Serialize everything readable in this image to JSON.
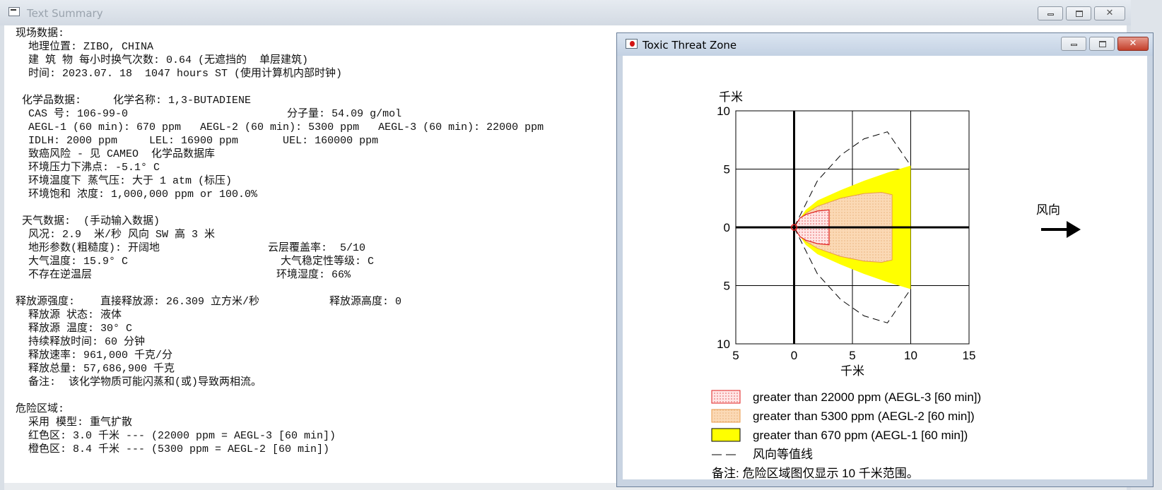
{
  "text_window": {
    "title": "Text Summary",
    "lines": [
      "现场数据:",
      "  地理位置: ZIBO, CHINA",
      "  建 筑 物 每小时换气次数: 0.64 (无遮挡的  单层建筑)",
      "  时间: 2023.07. 18  1047 hours ST (使用计算机内部时钟)",
      "",
      " 化学品数据:     化学名称: 1,3-BUTADIENE",
      "  CAS 号: 106-99-0                         分子量: 54.09 g/mol",
      "  AEGL-1 (60 min): 670 ppm   AEGL-2 (60 min): 5300 ppm   AEGL-3 (60 min): 22000 ppm",
      "  IDLH: 2000 ppm     LEL: 16900 ppm       UEL: 160000 ppm",
      "  致癌风险 - 见 CAMEO  化学品数据库",
      "  环境压力下沸点: -5.1° C",
      "  环境温度下 蒸气压: 大于 1 atm (标压)",
      "  环境饱和 浓度: 1,000,000 ppm or 100.0%",
      "",
      " 天气数据:  (手动输入数据)",
      "  风况: 2.9  米/秒 风向 SW 高 3 米",
      "  地形参数(粗糙度): 开阔地                 云层覆盖率:  5/10",
      "  大气温度: 15.9° C                        大气稳定性等级: C",
      "  不存在逆温层                             环境湿度: 66%",
      "",
      "释放源强度:    直接释放源: 26.309 立方米/秒           释放源高度: 0",
      "  释放源 状态: 液体",
      "  释放源 温度: 30° C",
      "  持续释放时间: 60 分钟",
      "  释放速率: 961,000 千克/分",
      "  释放总量: 57,686,900 千克",
      "  备注:  该化学物质可能闪蒸和(或)导致两相流。",
      "",
      "危险区域:",
      "  采用 模型: 重气扩散",
      "  红色区: 3.0 千米 --- (22000 ppm = AEGL-3 [60 min])",
      "  橙色区: 8.4 千米 --- (5300 ppm = AEGL-2 [60 min])"
    ]
  },
  "threat_window": {
    "title": "Toxic Threat Zone",
    "wind_label": "风向",
    "note": "备注: 危险区域图仅显示 10 千米范围。"
  },
  "chart_data": {
    "type": "area",
    "ylabel": "千米",
    "xlabel": "千米",
    "xlim": [
      -5,
      15
    ],
    "ylim": [
      -10,
      10
    ],
    "x_ticks": [
      "5",
      "0",
      "5",
      "10",
      "15"
    ],
    "y_ticks": [
      "10",
      "5",
      "0",
      "5",
      "10"
    ],
    "x_tick_values": [
      -5,
      0,
      5,
      10,
      15
    ],
    "y_tick_values": [
      10,
      5,
      0,
      -5,
      -10
    ],
    "grid": true,
    "series": [
      {
        "name": "greater than 670 ppm (AEGL-1 [60 min])",
        "color": "#ffff00",
        "x": [
          0,
          1,
          2,
          4,
          6,
          8,
          10
        ],
        "y_upper": [
          0,
          1.5,
          2.3,
          3.2,
          4.0,
          4.7,
          5.3
        ],
        "y_lower": [
          0,
          -1.5,
          -2.3,
          -3.2,
          -4.0,
          -4.7,
          -5.3
        ]
      },
      {
        "name": "greater than 5300 ppm (AEGL-2 [60 min])",
        "color": "#fbd9b5",
        "x": [
          0,
          1,
          2,
          4,
          6,
          7.5,
          8.4,
          8.4
        ],
        "y_upper": [
          0,
          1.2,
          1.8,
          2.5,
          2.9,
          3.0,
          2.8,
          0
        ],
        "y_lower": [
          0,
          -1.2,
          -1.8,
          -2.5,
          -2.9,
          -3.0,
          -2.8,
          0
        ]
      },
      {
        "name": "greater than 22000 ppm (AEGL-3 [60 min])",
        "color": "#ffd6d6",
        "x": [
          0,
          0.5,
          1,
          2,
          3,
          3
        ],
        "y_upper": [
          0,
          0.8,
          1.1,
          1.4,
          1.5,
          0
        ],
        "y_lower": [
          0,
          -0.8,
          -1.1,
          -1.4,
          -1.5,
          0
        ]
      },
      {
        "name": "风向等值线",
        "color": "#000000",
        "x": [
          0,
          2,
          4,
          6,
          8,
          10
        ],
        "y_upper": [
          0,
          4.0,
          6.2,
          7.6,
          8.2,
          5.3
        ],
        "y_lower": [
          0,
          -4.0,
          -6.2,
          -7.6,
          -8.2,
          -5.3
        ]
      }
    ]
  }
}
